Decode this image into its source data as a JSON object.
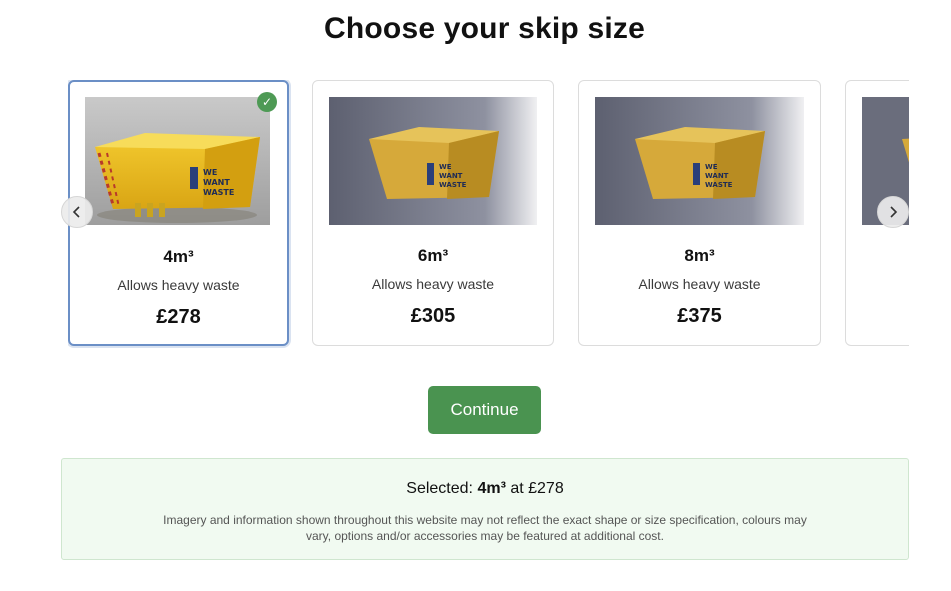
{
  "page": {
    "title": "Choose your skip size"
  },
  "carousel": {
    "items": [
      {
        "size": "4m³",
        "note": "Allows heavy waste",
        "price": "£278",
        "selected": true,
        "image_alt": "Yellow skip with We Want Waste logo"
      },
      {
        "size": "6m³",
        "note": "Allows heavy waste",
        "price": "£305",
        "selected": false,
        "image_alt": "Yellow skip with We Want Waste logo"
      },
      {
        "size": "8m³",
        "note": "Allows heavy waste",
        "price": "£375",
        "selected": false,
        "image_alt": "Yellow skip with We Want Waste logo"
      },
      {
        "size": "",
        "note": "",
        "price": "",
        "selected": false,
        "image_alt": "Yellow skip (partially visible)"
      }
    ],
    "prev_icon": "chevron-left-icon",
    "next_icon": "chevron-right-icon",
    "selected_icon": "checkmark-icon"
  },
  "actions": {
    "continue_label": "Continue"
  },
  "summary": {
    "selected_prefix": "Selected: ",
    "selected_size": "4m³",
    "selected_middle": " at ",
    "selected_price": "£278",
    "disclaimer": "Imagery and information shown throughout this website may not reflect the exact shape or size specification, colours may vary, options and/or accessories may be featured at additional cost."
  },
  "colors": {
    "accent_green": "#4a9350",
    "selected_border": "#6b8fc6",
    "summary_bg": "#f1faf1",
    "skip_yellow": "#e8b820"
  }
}
